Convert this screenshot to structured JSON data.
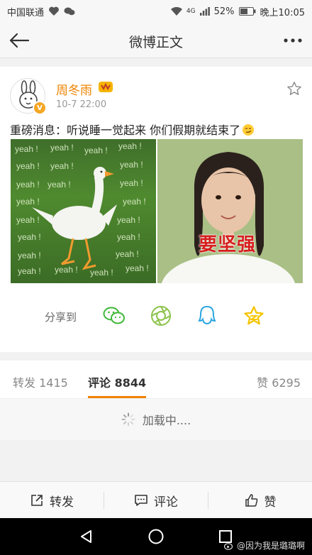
{
  "status_bar": {
    "carrier": "中国联通",
    "battery": "52%",
    "time": "晚上10:05",
    "network": "4G"
  },
  "nav": {
    "title": "微博正文"
  },
  "post": {
    "username": "周冬雨",
    "time": "10-7 22:00",
    "verified_badge": "V",
    "text": "重磅消息：听说睡一觉起来 你们假期就结束了",
    "images": [
      {
        "name": "goose-yeah-meme",
        "overlay_text": "yeah !"
      },
      {
        "name": "girl-braids-meme",
        "caption": "要坚强"
      }
    ]
  },
  "share": {
    "label": "分享到",
    "icons": [
      "wechat-icon",
      "moments-icon",
      "qq-icon",
      "qzone-icon"
    ]
  },
  "tabs": [
    {
      "label": "转发",
      "count": "1415"
    },
    {
      "label": "评论",
      "count": "8844"
    },
    {
      "label": "赞",
      "count": "6295"
    }
  ],
  "loading_text": "加载中....",
  "actions": {
    "repost": "转发",
    "comment": "评论",
    "like": "赞"
  },
  "watermark": "@因为我是璐璐啊",
  "colors": {
    "accent": "#f08300",
    "share_wechat": "#3fb837",
    "share_moments": "#8bc34a",
    "share_qq": "#2ba6e1",
    "share_qzone": "#f5c400"
  }
}
